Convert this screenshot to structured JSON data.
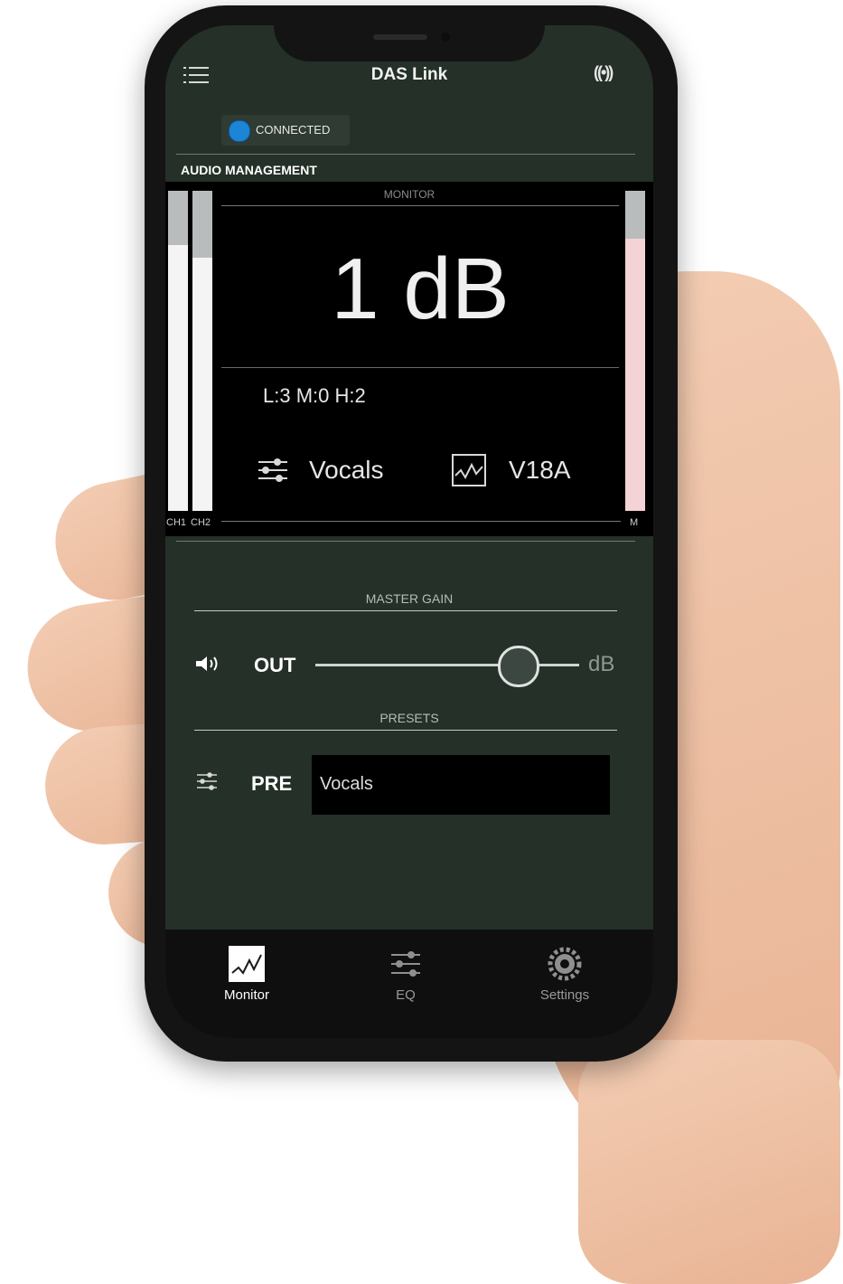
{
  "header": {
    "title": "DAS Link",
    "menu_icon": "menu-icon",
    "wireless_icon": "wireless-icon",
    "wireless_glyph": "((•))"
  },
  "status": {
    "label": "CONNECTED",
    "dot_color": "#1b86d6"
  },
  "section": {
    "title": "AUDIO MANAGEMENT"
  },
  "monitor": {
    "label": "MONITOR",
    "value": "1 dB",
    "levels": "L:3 M:0 H:2",
    "preset": "Vocals",
    "model": "V18A",
    "meters": [
      {
        "label": "CH1",
        "level": 0.83
      },
      {
        "label": "CH2",
        "level": 0.79
      },
      {
        "label": "M",
        "level": 0.85,
        "color": "#f3d3d6"
      }
    ]
  },
  "master_gain": {
    "title": "MASTER GAIN",
    "out_label": "OUT",
    "unit": "dB",
    "slider_value": 0.77
  },
  "presets": {
    "title": "PRESETS",
    "pre_label": "PRE",
    "value": "Vocals"
  },
  "nav": {
    "items": [
      {
        "label": "Monitor",
        "icon": "waveform-icon",
        "active": true
      },
      {
        "label": "EQ",
        "icon": "sliders-icon",
        "active": false
      },
      {
        "label": "Settings",
        "icon": "gear-icon",
        "active": false
      }
    ]
  },
  "colors": {
    "app_bg": "#243028",
    "panel_bg": "#000000",
    "accent": "#1b86d6"
  }
}
